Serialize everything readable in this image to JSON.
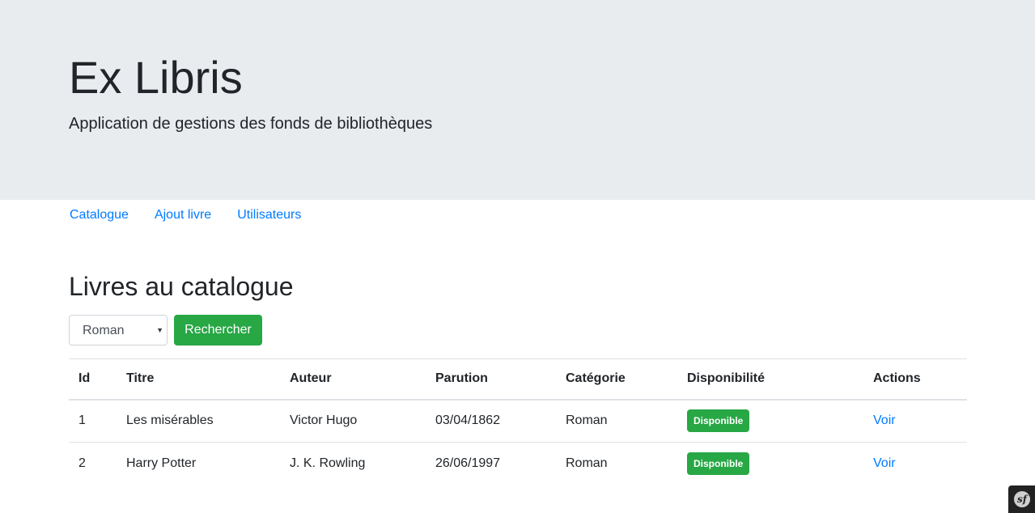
{
  "header": {
    "title": "Ex Libris",
    "lead": "Application de gestions des fonds de bibliothèques"
  },
  "nav": {
    "items": [
      {
        "label": "Catalogue"
      },
      {
        "label": "Ajout livre"
      },
      {
        "label": "Utilisateurs"
      }
    ]
  },
  "main": {
    "title": "Livres au catalogue",
    "filter": {
      "selected": "Roman",
      "button_label": "Rechercher"
    },
    "table": {
      "headers": [
        "Id",
        "Titre",
        "Auteur",
        "Parution",
        "Catégorie",
        "Disponibilité",
        "Actions"
      ],
      "rows": [
        {
          "id": "1",
          "title": "Les misérables",
          "author": "Victor Hugo",
          "date": "03/04/1862",
          "category": "Roman",
          "status": "Disponible",
          "action": "Voir"
        },
        {
          "id": "2",
          "title": "Harry Potter",
          "author": "J. K. Rowling",
          "date": "26/06/1997",
          "category": "Roman",
          "status": "Disponible",
          "action": "Voir"
        }
      ]
    }
  },
  "debug_toolbar": {
    "icon": "symfony-logo-icon",
    "glyph": "sf"
  },
  "colors": {
    "jumbotron_bg": "#e9ecef",
    "link": "#007bff",
    "success": "#28a745"
  }
}
